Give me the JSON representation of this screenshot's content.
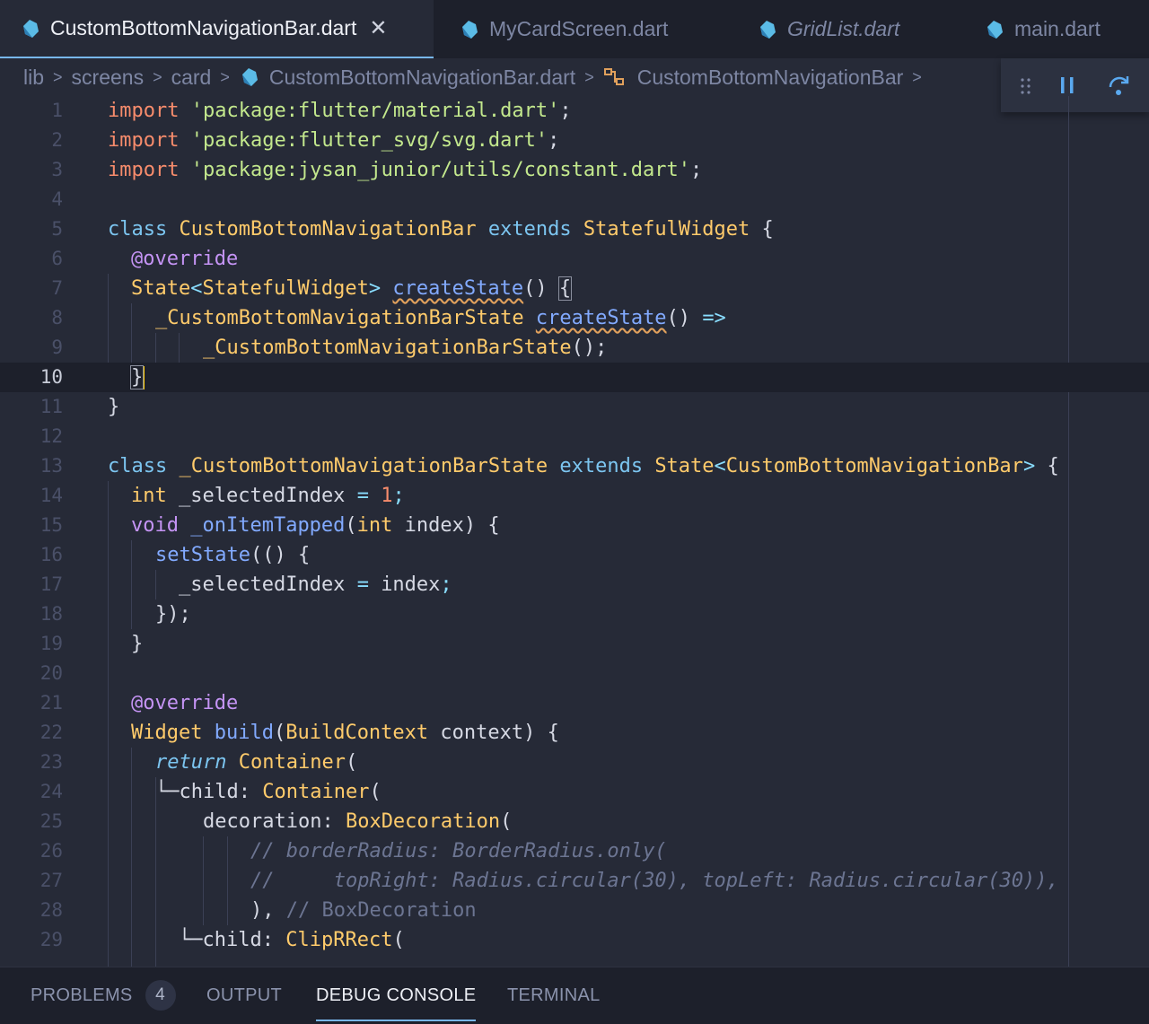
{
  "tabs": [
    {
      "label": "CustomBottomNavigationBar.dart",
      "active": true,
      "italic": false,
      "icon": "dart-file-icon"
    },
    {
      "label": "MyCardScreen.dart",
      "active": false,
      "italic": false,
      "icon": "dart-file-icon"
    },
    {
      "label": "GridList.dart",
      "active": false,
      "italic": true,
      "icon": "dart-file-icon"
    },
    {
      "label": "main.dart",
      "active": false,
      "italic": false,
      "icon": "dart-file-icon"
    }
  ],
  "tab_close_glyph": "✕",
  "breadcrumb": {
    "items": [
      "lib",
      "screens",
      "card",
      "CustomBottomNavigationBar.dart",
      "CustomBottomNavigationBar"
    ],
    "separator": ">"
  },
  "debug_toolbar": {
    "buttons": [
      "drag-grip-icon",
      "pause-icon",
      "step-over-icon"
    ]
  },
  "editor": {
    "current_line": 10,
    "lines": [
      {
        "n": "1"
      },
      {
        "n": "2"
      },
      {
        "n": "3"
      },
      {
        "n": "4"
      },
      {
        "n": "5"
      },
      {
        "n": "6"
      },
      {
        "n": "7"
      },
      {
        "n": "8"
      },
      {
        "n": "9"
      },
      {
        "n": "10"
      },
      {
        "n": "11"
      },
      {
        "n": "12"
      },
      {
        "n": "13"
      },
      {
        "n": "14"
      },
      {
        "n": "15"
      },
      {
        "n": "16"
      },
      {
        "n": "17"
      },
      {
        "n": "18"
      },
      {
        "n": "19"
      },
      {
        "n": "20"
      },
      {
        "n": "21"
      },
      {
        "n": "22"
      },
      {
        "n": "23"
      },
      {
        "n": "24"
      },
      {
        "n": "25"
      },
      {
        "n": "26"
      },
      {
        "n": "27"
      },
      {
        "n": "28"
      },
      {
        "n": "29"
      }
    ],
    "code": {
      "l1": {
        "kw": "import",
        "str": "'package:flutter/material.dart'",
        "end": ";"
      },
      "l2": {
        "kw": "import",
        "str": "'package:flutter_svg/svg.dart'",
        "end": ";"
      },
      "l3": {
        "kw": "import",
        "str": "'package:jysan_junior/utils/constant.dart'",
        "end": ";"
      },
      "l5": {
        "kw": "class",
        "name": "CustomBottomNavigationBar",
        "ext": "extends",
        "base": "StatefulWidget",
        "open": "{"
      },
      "l6": {
        "ann": "@override"
      },
      "l7": {
        "ty1": "State",
        "lt": "<",
        "ty2": "StatefulWidget",
        "gt": ">",
        "fn": "createState",
        "paren": "()",
        "open": "{"
      },
      "l8": {
        "ty": "_CustomBottomNavigationBarState",
        "fn": "createState",
        "paren": "()",
        "arrow": "=>"
      },
      "l9": {
        "ty": "_CustomBottomNavigationBarState",
        "end": "();"
      },
      "l10": {
        "close": "}"
      },
      "l11": {
        "close": "}"
      },
      "l13": {
        "kw": "class",
        "name": "_CustomBottomNavigationBarState",
        "ext": "extends",
        "base": "State",
        "lt": "<",
        "gen": "CustomBottomNavigationBar",
        "gt": ">",
        "open": "{"
      },
      "l14": {
        "ty": "int",
        "id": "_selectedIndex",
        "eq": "=",
        "num": "1",
        "end": ";"
      },
      "l15": {
        "kw": "void",
        "fn": "_onItemTapped",
        "p1": "(",
        "ty": "int",
        "id": "index",
        "p2": ")",
        "open": "{"
      },
      "l16": {
        "fn": "setState",
        "rest": "(() {"
      },
      "l17": {
        "id": "_selectedIndex",
        "eq": "=",
        "val": "index",
        "end": ";"
      },
      "l18": {
        "close": "});"
      },
      "l19": {
        "close": "}"
      },
      "l21": {
        "ann": "@override"
      },
      "l22": {
        "ty": "Widget",
        "fn": "build",
        "p1": "(",
        "ty2": "BuildContext",
        "id": "context",
        "p2": ")",
        "open": "{"
      },
      "l23": {
        "ret": "return",
        "ty": "Container",
        "p": "("
      },
      "l24": {
        "tree": "└─",
        "prop": "child:",
        "ty": "Container",
        "p": "("
      },
      "l25": {
        "prop": "decoration:",
        "ty": "BoxDecoration",
        "p": "("
      },
      "l26": {
        "cm": "// borderRadius: BorderRadius.only("
      },
      "l27": {
        "cm": "//     topRight: Radius.circular(30), topLeft: Radius.circular(30)),"
      },
      "l28": {
        "close": "),",
        "cm": "// BoxDecoration"
      },
      "l29": {
        "tree": "└─",
        "prop": "child:",
        "ty": "ClipRRect",
        "p": "("
      }
    }
  },
  "panel": {
    "tabs": [
      {
        "label": "PROBLEMS",
        "badge": "4",
        "active": false
      },
      {
        "label": "OUTPUT",
        "active": false
      },
      {
        "label": "DEBUG CONSOLE",
        "active": true
      },
      {
        "label": "TERMINAL",
        "active": false
      }
    ]
  },
  "colors": {
    "accent": "#78b7ee",
    "cursor": "#ffcc00",
    "background": "#262a37",
    "tab_bar": "#1d202b"
  }
}
